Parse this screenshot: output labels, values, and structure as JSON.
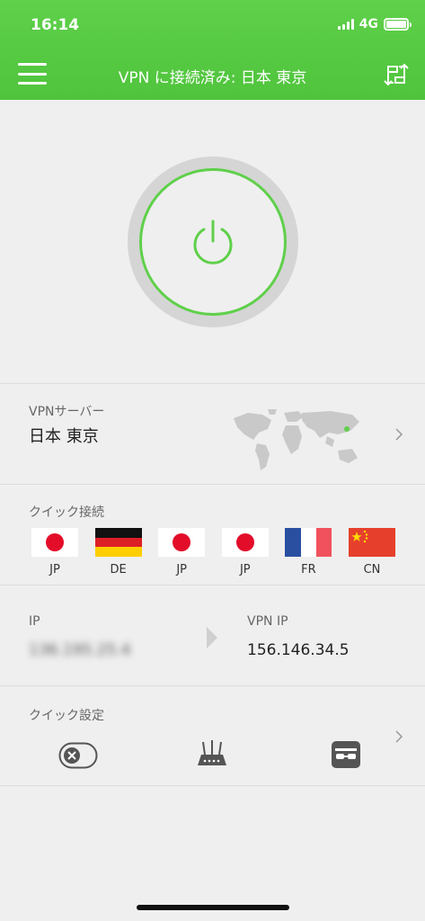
{
  "status": {
    "time": "16:14",
    "network": "4G"
  },
  "header": {
    "title": "VPN に接続済み: 日本 東京",
    "menu_icon": "hamburger-menu-icon",
    "switch_icon": "server-switch-icon"
  },
  "power": {
    "icon": "power-icon",
    "connected_color": "#5fd04a",
    "state": "connected"
  },
  "server": {
    "label": "VPNサーバー",
    "name": "日本 東京",
    "map_icon": "world-map-icon"
  },
  "quick_connect": {
    "label": "クイック接続",
    "flags": [
      {
        "code": "JP",
        "icon": "japan-flag-icon"
      },
      {
        "code": "DE",
        "icon": "germany-flag-icon"
      },
      {
        "code": "JP",
        "icon": "japan-flag-icon"
      },
      {
        "code": "JP",
        "icon": "japan-flag-icon"
      },
      {
        "code": "FR",
        "icon": "france-flag-icon"
      },
      {
        "code": "CN",
        "icon": "china-flag-icon"
      }
    ]
  },
  "ip": {
    "label": "IP",
    "value": "136.195.25.4",
    "vpn_label": "VPN IP",
    "vpn_value": "156.146.34.5"
  },
  "quick_settings": {
    "label": "クイック設定",
    "icons": [
      "block-toggle-icon",
      "router-icon",
      "incognito-icon"
    ]
  },
  "colors": {
    "brand": "#4fc43c",
    "background": "#efefef"
  }
}
